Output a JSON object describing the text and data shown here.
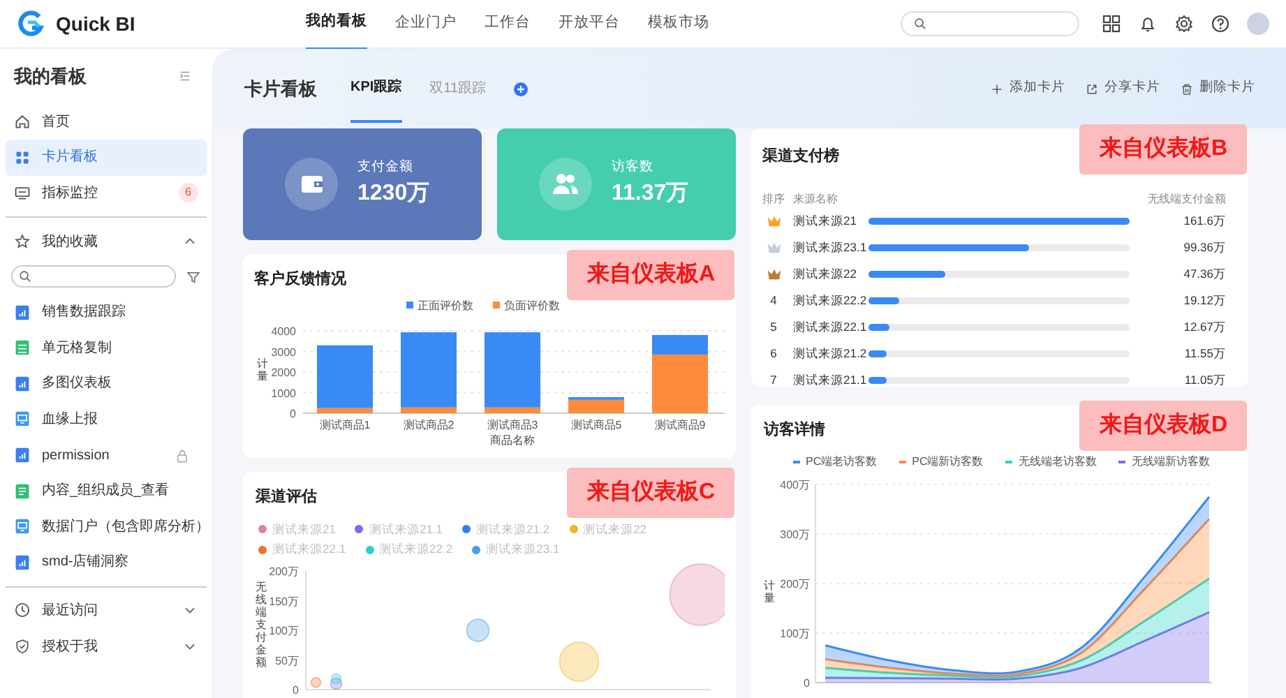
{
  "top_nav": {
    "logo": "Quick BI",
    "tabs": [
      {
        "label": "我的看板",
        "selected": true
      },
      {
        "label": "企业门户",
        "selected": false
      },
      {
        "label": "工作台",
        "selected": false
      },
      {
        "label": "开放平台",
        "selected": false
      },
      {
        "label": "模板市场",
        "selected": false
      }
    ]
  },
  "sidebar": {
    "title": "我的看板",
    "nav": [
      {
        "label": "首页",
        "selected": false
      },
      {
        "label": "卡片看板",
        "selected": true
      },
      {
        "label": "指标监控",
        "selected": false,
        "badge": "6"
      }
    ],
    "favorites": {
      "label": "我的收藏",
      "expanded": true,
      "items": [
        {
          "label": "销售数据跟踪",
          "kind": "dashboard",
          "locked": false
        },
        {
          "label": "单元格复制",
          "kind": "spreadsheet",
          "locked": false
        },
        {
          "label": "多图仪表板",
          "kind": "dashboard",
          "locked": false
        },
        {
          "label": "血缘上报",
          "kind": "screen",
          "locked": false
        },
        {
          "label": "permission",
          "kind": "dashboard",
          "locked": true
        },
        {
          "label": "内容_组织成员_查看",
          "kind": "report",
          "locked": false
        },
        {
          "label": "数据门户（包含即席分析）",
          "kind": "screen",
          "locked": false
        },
        {
          "label": "smd-店铺洞察",
          "kind": "dashboard",
          "locked": false
        }
      ]
    },
    "sections": [
      {
        "label": "最近访问",
        "expanded": false
      },
      {
        "label": "授权于我",
        "expanded": false
      }
    ]
  },
  "header": {
    "title": "卡片看板",
    "tabs": [
      {
        "label": "KPI跟踪",
        "selected": true
      },
      {
        "label": "双11跟踪",
        "selected": false
      }
    ],
    "actions": [
      "添加卡片",
      "分享卡片",
      "删除卡片"
    ]
  },
  "kpis": [
    {
      "label": "支付金额",
      "value": "1230万",
      "color": "#5b78b8"
    },
    {
      "label": "访客数",
      "value": "11.37万",
      "color": "#45cdb0"
    }
  ],
  "feedback": {
    "title": "客户反馈情况",
    "overlay_label": "来自仪表板A",
    "chart_data": {
      "type": "bar",
      "stacked": true,
      "grid": true,
      "legend": true,
      "xlabel": "商品名称",
      "ylabel": "计量",
      "categories": [
        "测试商品1",
        "测试商品2",
        "测试商品3",
        "测试商品5",
        "测试商品9"
      ],
      "ylim": [
        0,
        4000
      ],
      "yticks": [
        0,
        1000,
        2000,
        3000,
        4000
      ],
      "series": [
        {
          "name": "正面评价数",
          "color": "#3a8af5",
          "values": [
            3050,
            3650,
            3650,
            130,
            950
          ]
        },
        {
          "name": "负面评价数",
          "color": "#ff8b3d",
          "values": [
            250,
            280,
            280,
            650,
            2850
          ]
        }
      ]
    }
  },
  "ranking": {
    "title": "渠道支付榜",
    "overlay_label": "来自仪表板B",
    "columns": [
      "排序",
      "来源名称",
      "无线端支付金额"
    ],
    "rows": [
      {
        "kind": "crown",
        "color": "#f5a623",
        "name": "测试来源21",
        "level": 1,
        "value": "161.6万"
      },
      {
        "kind": "crown",
        "color": "#c5cdd8",
        "name": "测试来源23.1",
        "level": 0.615,
        "value": "99.36万"
      },
      {
        "kind": "crown",
        "color": "#c07a3a",
        "name": "测试来源22",
        "level": 0.293,
        "value": "47.36万"
      },
      {
        "kind": "number",
        "rank": "4",
        "name": "测试来源22.2",
        "level": 0.118,
        "value": "19.12万"
      },
      {
        "kind": "number",
        "rank": "5",
        "name": "测试来源22.1",
        "level": 0.078,
        "value": "12.67万"
      },
      {
        "kind": "number",
        "rank": "6",
        "name": "测试来源21.2",
        "level": 0.071,
        "value": "11.55万"
      },
      {
        "kind": "number",
        "rank": "7",
        "name": "测试来源21.1",
        "level": 0.068,
        "value": "11.05万"
      }
    ]
  },
  "channel_eval": {
    "title": "渠道评估",
    "overlay_label": "来自仪表板C",
    "chart_data": {
      "type": "scatter",
      "legend": true,
      "ylabel": "无线端支付金额",
      "categories": [
        null,
        null,
        null,
        null,
        null,
        null,
        null,
        null,
        null,
        null,
        null,
        null,
        null,
        null,
        null,
        null,
        null,
        null,
        null,
        null
      ],
      "ylim": [
        0,
        200
      ],
      "yticks": [
        {
          "value": 0,
          "label": "0"
        },
        {
          "value": 50,
          "label": "50万"
        },
        {
          "value": 100,
          "label": "100万"
        },
        {
          "value": 150,
          "label": "150万"
        },
        {
          "value": 200,
          "label": "200万"
        }
      ],
      "series": [
        {
          "name": "测试来源21",
          "color": "#e0829f",
          "values": [
            null,
            null,
            null,
            null,
            null,
            null,
            null,
            null,
            null,
            null,
            null,
            null,
            null,
            null,
            null,
            null,
            null,
            null,
            null,
            160
          ]
        },
        {
          "name": "测试来源21.1",
          "color": "#7b6cf0",
          "values": [
            null,
            10,
            null,
            null,
            null,
            null,
            null,
            null,
            null,
            null,
            null,
            null,
            null,
            null,
            null,
            null,
            null,
            null,
            null,
            null
          ]
        },
        {
          "name": "测试来源21.2",
          "color": "#2f7ff6",
          "values": [
            null,
            null,
            null,
            null,
            null,
            null,
            null,
            null,
            null,
            null,
            null,
            null,
            null,
            null,
            null,
            null,
            null,
            null,
            null,
            null
          ]
        },
        {
          "name": "测试来源22",
          "color": "#f5b324",
          "values": [
            null,
            null,
            null,
            null,
            null,
            null,
            null,
            null,
            null,
            null,
            null,
            null,
            null,
            47,
            null,
            null,
            null,
            null,
            null,
            null
          ]
        },
        {
          "name": "测试来源22.1",
          "color": "#f07030",
          "values": [
            12,
            null,
            null,
            null,
            null,
            null,
            null,
            null,
            null,
            null,
            null,
            null,
            null,
            null,
            null,
            null,
            null,
            null,
            null,
            null
          ]
        },
        {
          "name": "测试来源22.2",
          "color": "#2fd0c8",
          "values": [
            null,
            18,
            null,
            null,
            null,
            null,
            null,
            null,
            null,
            null,
            null,
            null,
            null,
            null,
            null,
            null,
            null,
            null,
            null,
            null
          ]
        },
        {
          "name": "测试来源23.1",
          "color": "#4a9de0",
          "values": [
            null,
            null,
            null,
            null,
            null,
            null,
            null,
            null,
            100,
            null,
            null,
            null,
            null,
            null,
            null,
            null,
            null,
            null,
            null,
            null
          ]
        }
      ]
    }
  },
  "visitors": {
    "title": "访客详情",
    "overlay_label": "来自仪表板D",
    "chart_data": {
      "type": "area",
      "stacked": true,
      "grid": true,
      "legend": true,
      "ylabel": "计量",
      "ylim": [
        0,
        400
      ],
      "yticks": [
        {
          "value": 0,
          "label": "0"
        },
        {
          "value": 100,
          "label": "100万"
        },
        {
          "value": 200,
          "label": "200万"
        },
        {
          "value": 300,
          "label": "300万"
        },
        {
          "value": 400,
          "label": "400万"
        }
      ],
      "series": [
        {
          "name": "PC端老访客数",
          "color": "#3a8af5",
          "values": [
            28,
            15,
            7,
            5,
            10,
            25,
            45
          ]
        },
        {
          "name": "PC端新访客数",
          "color": "#ff8b3d",
          "values": [
            17,
            10,
            4,
            4,
            15,
            65,
            120
          ]
        },
        {
          "name": "无线端老访客数",
          "color": "#2fd4c4",
          "values": [
            20,
            11,
            6,
            5,
            15,
            40,
            68
          ]
        },
        {
          "name": "无线端新访客数",
          "color": "#7b6cf0",
          "values": [
            10,
            9,
            8,
            8,
            30,
            85,
            142
          ]
        }
      ]
    }
  }
}
